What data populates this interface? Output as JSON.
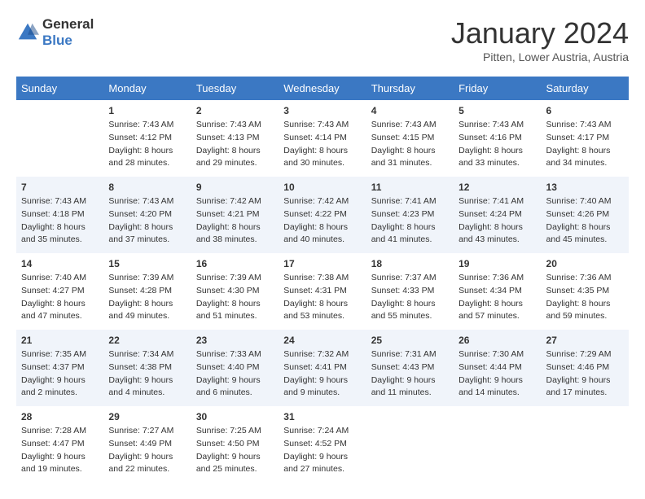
{
  "header": {
    "logo_line1": "General",
    "logo_line2": "Blue",
    "title": "January 2024",
    "subtitle": "Pitten, Lower Austria, Austria"
  },
  "weekdays": [
    "Sunday",
    "Monday",
    "Tuesday",
    "Wednesday",
    "Thursday",
    "Friday",
    "Saturday"
  ],
  "weeks": [
    [
      {
        "day": "",
        "sunrise": "",
        "sunset": "",
        "daylight": ""
      },
      {
        "day": "1",
        "sunrise": "Sunrise: 7:43 AM",
        "sunset": "Sunset: 4:12 PM",
        "daylight": "Daylight: 8 hours and 28 minutes."
      },
      {
        "day": "2",
        "sunrise": "Sunrise: 7:43 AM",
        "sunset": "Sunset: 4:13 PM",
        "daylight": "Daylight: 8 hours and 29 minutes."
      },
      {
        "day": "3",
        "sunrise": "Sunrise: 7:43 AM",
        "sunset": "Sunset: 4:14 PM",
        "daylight": "Daylight: 8 hours and 30 minutes."
      },
      {
        "day": "4",
        "sunrise": "Sunrise: 7:43 AM",
        "sunset": "Sunset: 4:15 PM",
        "daylight": "Daylight: 8 hours and 31 minutes."
      },
      {
        "day": "5",
        "sunrise": "Sunrise: 7:43 AM",
        "sunset": "Sunset: 4:16 PM",
        "daylight": "Daylight: 8 hours and 33 minutes."
      },
      {
        "day": "6",
        "sunrise": "Sunrise: 7:43 AM",
        "sunset": "Sunset: 4:17 PM",
        "daylight": "Daylight: 8 hours and 34 minutes."
      }
    ],
    [
      {
        "day": "7",
        "sunrise": "Sunrise: 7:43 AM",
        "sunset": "Sunset: 4:18 PM",
        "daylight": "Daylight: 8 hours and 35 minutes."
      },
      {
        "day": "8",
        "sunrise": "Sunrise: 7:43 AM",
        "sunset": "Sunset: 4:20 PM",
        "daylight": "Daylight: 8 hours and 37 minutes."
      },
      {
        "day": "9",
        "sunrise": "Sunrise: 7:42 AM",
        "sunset": "Sunset: 4:21 PM",
        "daylight": "Daylight: 8 hours and 38 minutes."
      },
      {
        "day": "10",
        "sunrise": "Sunrise: 7:42 AM",
        "sunset": "Sunset: 4:22 PM",
        "daylight": "Daylight: 8 hours and 40 minutes."
      },
      {
        "day": "11",
        "sunrise": "Sunrise: 7:41 AM",
        "sunset": "Sunset: 4:23 PM",
        "daylight": "Daylight: 8 hours and 41 minutes."
      },
      {
        "day": "12",
        "sunrise": "Sunrise: 7:41 AM",
        "sunset": "Sunset: 4:24 PM",
        "daylight": "Daylight: 8 hours and 43 minutes."
      },
      {
        "day": "13",
        "sunrise": "Sunrise: 7:40 AM",
        "sunset": "Sunset: 4:26 PM",
        "daylight": "Daylight: 8 hours and 45 minutes."
      }
    ],
    [
      {
        "day": "14",
        "sunrise": "Sunrise: 7:40 AM",
        "sunset": "Sunset: 4:27 PM",
        "daylight": "Daylight: 8 hours and 47 minutes."
      },
      {
        "day": "15",
        "sunrise": "Sunrise: 7:39 AM",
        "sunset": "Sunset: 4:28 PM",
        "daylight": "Daylight: 8 hours and 49 minutes."
      },
      {
        "day": "16",
        "sunrise": "Sunrise: 7:39 AM",
        "sunset": "Sunset: 4:30 PM",
        "daylight": "Daylight: 8 hours and 51 minutes."
      },
      {
        "day": "17",
        "sunrise": "Sunrise: 7:38 AM",
        "sunset": "Sunset: 4:31 PM",
        "daylight": "Daylight: 8 hours and 53 minutes."
      },
      {
        "day": "18",
        "sunrise": "Sunrise: 7:37 AM",
        "sunset": "Sunset: 4:33 PM",
        "daylight": "Daylight: 8 hours and 55 minutes."
      },
      {
        "day": "19",
        "sunrise": "Sunrise: 7:36 AM",
        "sunset": "Sunset: 4:34 PM",
        "daylight": "Daylight: 8 hours and 57 minutes."
      },
      {
        "day": "20",
        "sunrise": "Sunrise: 7:36 AM",
        "sunset": "Sunset: 4:35 PM",
        "daylight": "Daylight: 8 hours and 59 minutes."
      }
    ],
    [
      {
        "day": "21",
        "sunrise": "Sunrise: 7:35 AM",
        "sunset": "Sunset: 4:37 PM",
        "daylight": "Daylight: 9 hours and 2 minutes."
      },
      {
        "day": "22",
        "sunrise": "Sunrise: 7:34 AM",
        "sunset": "Sunset: 4:38 PM",
        "daylight": "Daylight: 9 hours and 4 minutes."
      },
      {
        "day": "23",
        "sunrise": "Sunrise: 7:33 AM",
        "sunset": "Sunset: 4:40 PM",
        "daylight": "Daylight: 9 hours and 6 minutes."
      },
      {
        "day": "24",
        "sunrise": "Sunrise: 7:32 AM",
        "sunset": "Sunset: 4:41 PM",
        "daylight": "Daylight: 9 hours and 9 minutes."
      },
      {
        "day": "25",
        "sunrise": "Sunrise: 7:31 AM",
        "sunset": "Sunset: 4:43 PM",
        "daylight": "Daylight: 9 hours and 11 minutes."
      },
      {
        "day": "26",
        "sunrise": "Sunrise: 7:30 AM",
        "sunset": "Sunset: 4:44 PM",
        "daylight": "Daylight: 9 hours and 14 minutes."
      },
      {
        "day": "27",
        "sunrise": "Sunrise: 7:29 AM",
        "sunset": "Sunset: 4:46 PM",
        "daylight": "Daylight: 9 hours and 17 minutes."
      }
    ],
    [
      {
        "day": "28",
        "sunrise": "Sunrise: 7:28 AM",
        "sunset": "Sunset: 4:47 PM",
        "daylight": "Daylight: 9 hours and 19 minutes."
      },
      {
        "day": "29",
        "sunrise": "Sunrise: 7:27 AM",
        "sunset": "Sunset: 4:49 PM",
        "daylight": "Daylight: 9 hours and 22 minutes."
      },
      {
        "day": "30",
        "sunrise": "Sunrise: 7:25 AM",
        "sunset": "Sunset: 4:50 PM",
        "daylight": "Daylight: 9 hours and 25 minutes."
      },
      {
        "day": "31",
        "sunrise": "Sunrise: 7:24 AM",
        "sunset": "Sunset: 4:52 PM",
        "daylight": "Daylight: 9 hours and 27 minutes."
      },
      {
        "day": "",
        "sunrise": "",
        "sunset": "",
        "daylight": ""
      },
      {
        "day": "",
        "sunrise": "",
        "sunset": "",
        "daylight": ""
      },
      {
        "day": "",
        "sunrise": "",
        "sunset": "",
        "daylight": ""
      }
    ]
  ]
}
